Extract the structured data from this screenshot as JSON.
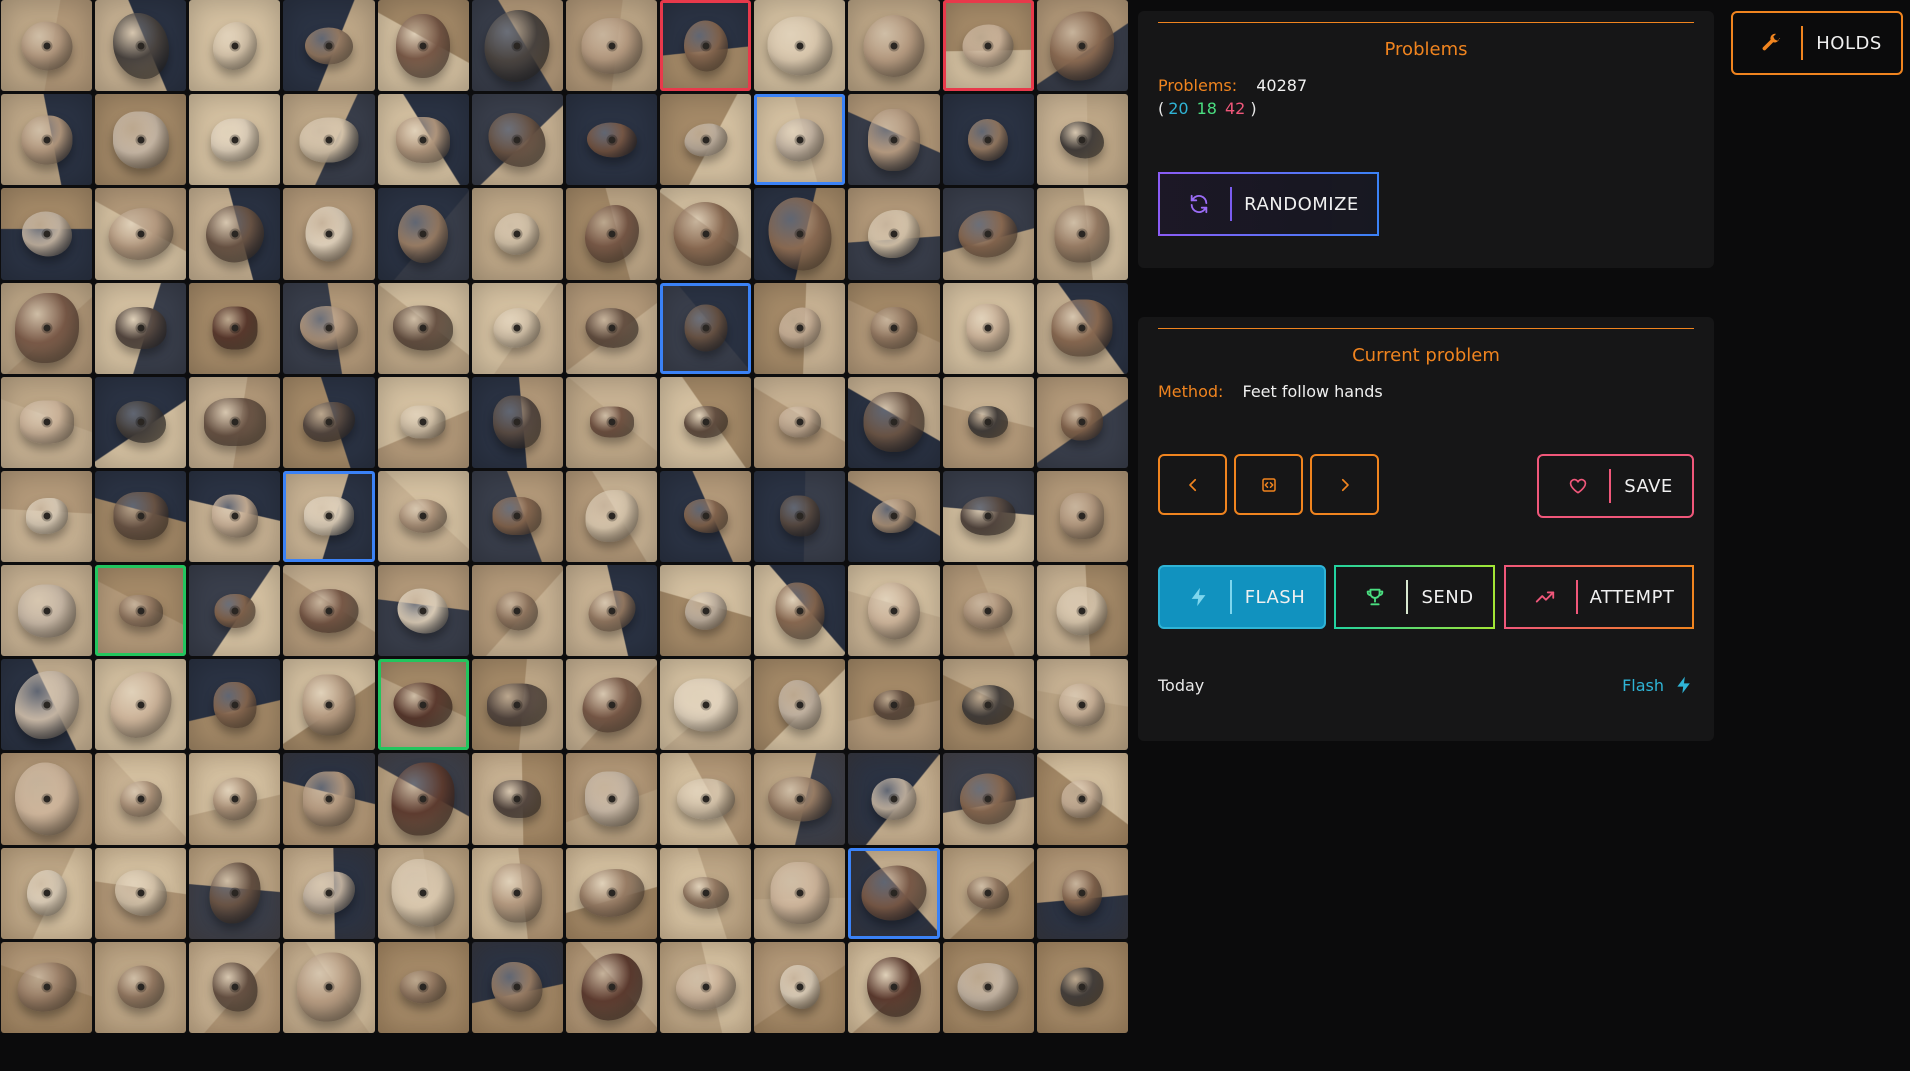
{
  "grid": {
    "columns": 12,
    "rows": 11,
    "selected": [
      {
        "index": 7,
        "color": "red"
      },
      {
        "index": 10,
        "color": "red"
      },
      {
        "index": 20,
        "color": "blue"
      },
      {
        "index": 43,
        "color": "blue"
      },
      {
        "index": 63,
        "color": "blue"
      },
      {
        "index": 73,
        "color": "green"
      },
      {
        "index": 88,
        "color": "green"
      },
      {
        "index": 117,
        "color": "blue"
      }
    ]
  },
  "problems_panel": {
    "title": "Problems",
    "count_label": "Problems:",
    "count_value": "40287",
    "open_paren": "(",
    "close_paren": ")",
    "flash_count": "20",
    "send_count": "18",
    "attempt_count": "42",
    "randomize_label": "RANDOMIZE",
    "randomize_icon": "refresh-icon"
  },
  "current_panel": {
    "title": "Current problem",
    "method_label": "Method:",
    "method_value": "Feet follow hands",
    "prev_icon": "chevron-left-icon",
    "mirror_icon": "code-icon",
    "next_icon": "chevron-right-icon",
    "save_label": "SAVE",
    "save_icon": "heart-icon",
    "flash_label": "FLASH",
    "flash_icon": "lightning-icon",
    "send_label": "SEND",
    "send_icon": "trophy-icon",
    "attempt_label": "ATTEMPT",
    "attempt_icon": "trending-up-icon",
    "log_date": "Today",
    "log_type": "Flash"
  },
  "holds_button": {
    "label": "HOLDS",
    "icon": "wrench-icon"
  },
  "colors": {
    "accent": "#f0841f",
    "flash": "#2fb4d6",
    "send": "#4ade80",
    "attempt": "#f0577a",
    "select_red": "#e8394b",
    "select_blue": "#3b82f6",
    "select_green": "#22c55e"
  }
}
